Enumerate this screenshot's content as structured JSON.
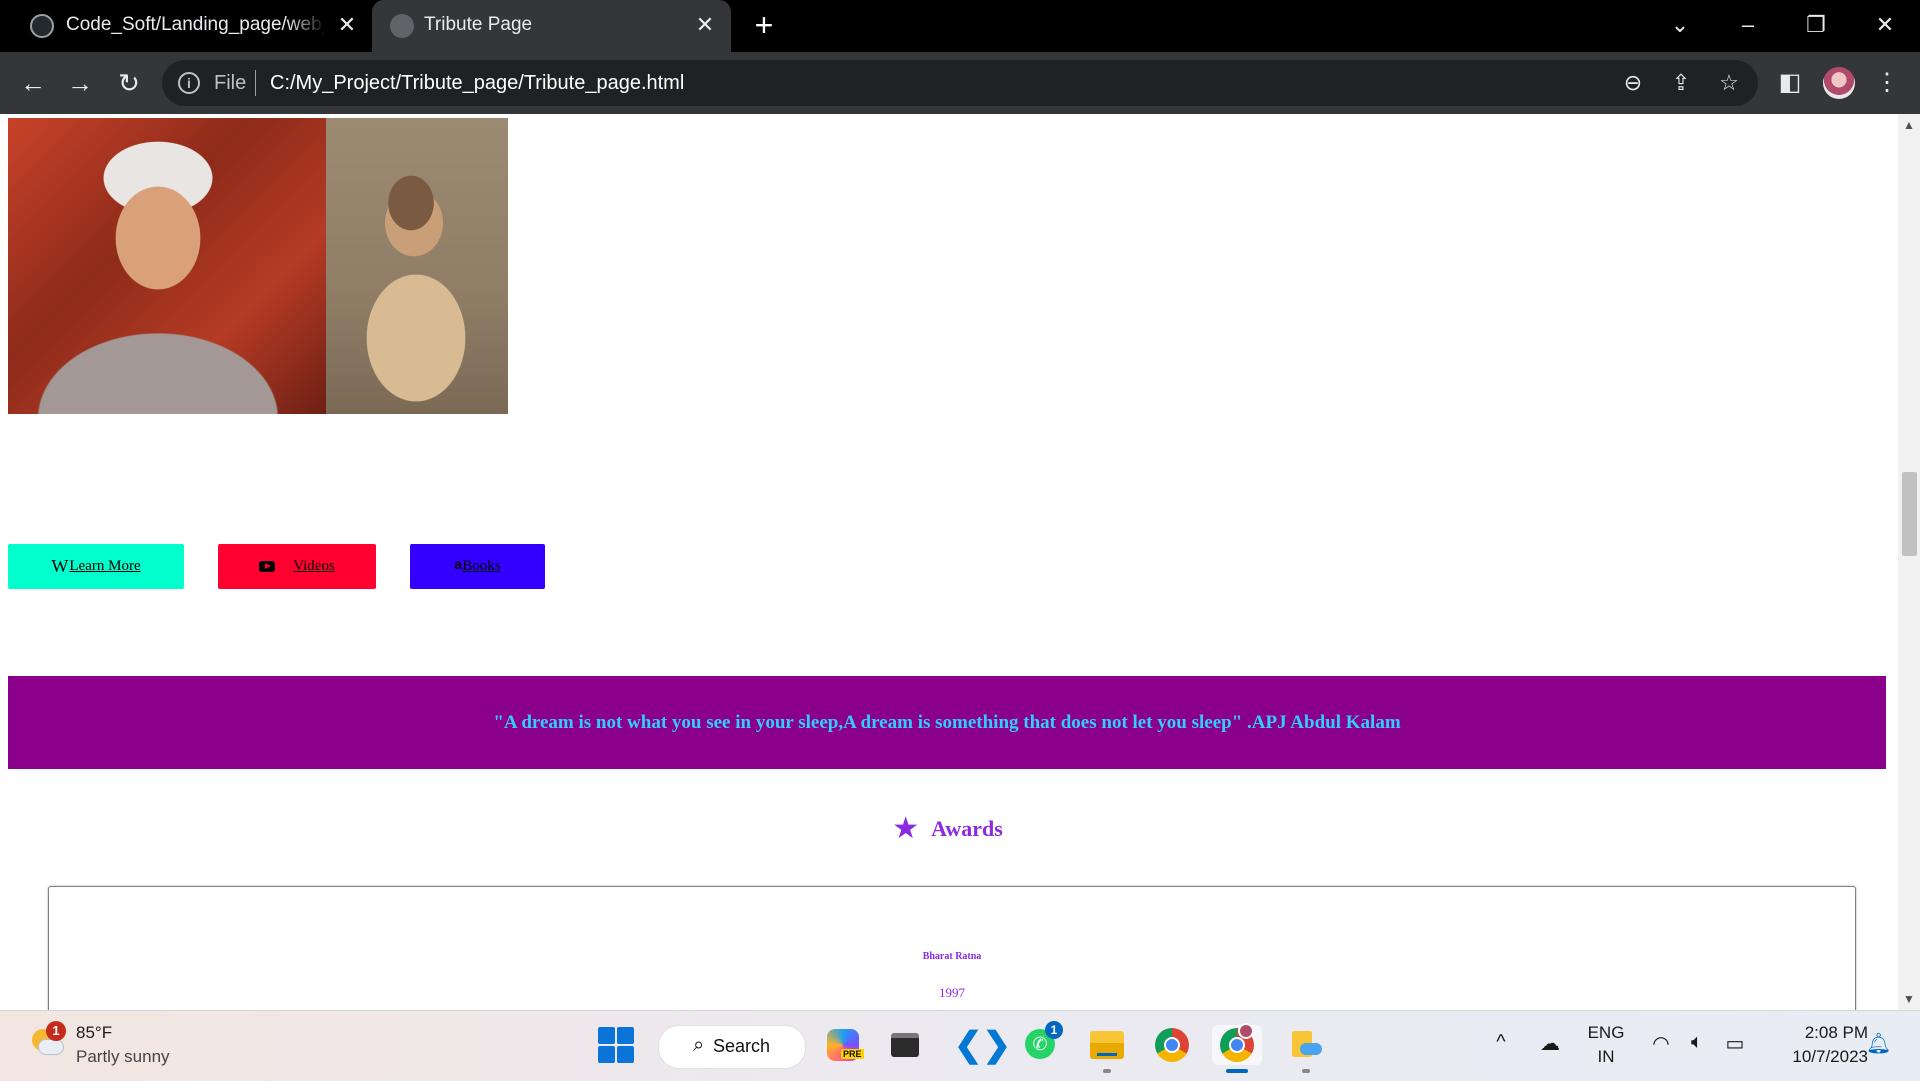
{
  "browser": {
    "tabs": [
      {
        "title": "Code_Soft/Landing_page/web_S",
        "active": false
      },
      {
        "title": "Tribute Page",
        "active": true
      }
    ],
    "new_tab_symbol": "+",
    "address": {
      "scheme_label": "File",
      "url": "C:/My_Project/Tribute_page/Tribute_page.html"
    },
    "icons": [
      "back-icon",
      "forward-icon",
      "reload-icon",
      "info-icon",
      "zoom-out-icon",
      "share-icon",
      "star-bookmark-icon",
      "side-panel-icon",
      "profile-avatar",
      "kebab-menu-icon"
    ]
  },
  "page": {
    "buttons": [
      {
        "icon": "W",
        "label": "Learn More",
        "color": "#00ffcc"
      },
      {
        "icon": "youtube-icon",
        "label": "Videos",
        "color": "#ff0030"
      },
      {
        "icon": "a",
        "label": "Books",
        "color": "#3300ff"
      }
    ],
    "quote": "\"A dream is not what you see in your sleep,A dream is something that does not let you sleep\" .APJ Abdul Kalam",
    "quote_bg": "#8b008b",
    "quote_color": "#33ccff",
    "awards_title": "Awards",
    "award": {
      "name": "Bharat Ratna",
      "year": "1997"
    },
    "accent": "#8a2be2"
  },
  "taskbar": {
    "weather": {
      "badge": "1",
      "temp": "85°F",
      "desc": "Partly sunny"
    },
    "search_label": "Search",
    "whatsapp_badge": "1",
    "lang": {
      "line1": "ENG",
      "line2": "IN"
    },
    "clock": {
      "time": "2:08 PM",
      "date": "10/7/2023"
    }
  }
}
